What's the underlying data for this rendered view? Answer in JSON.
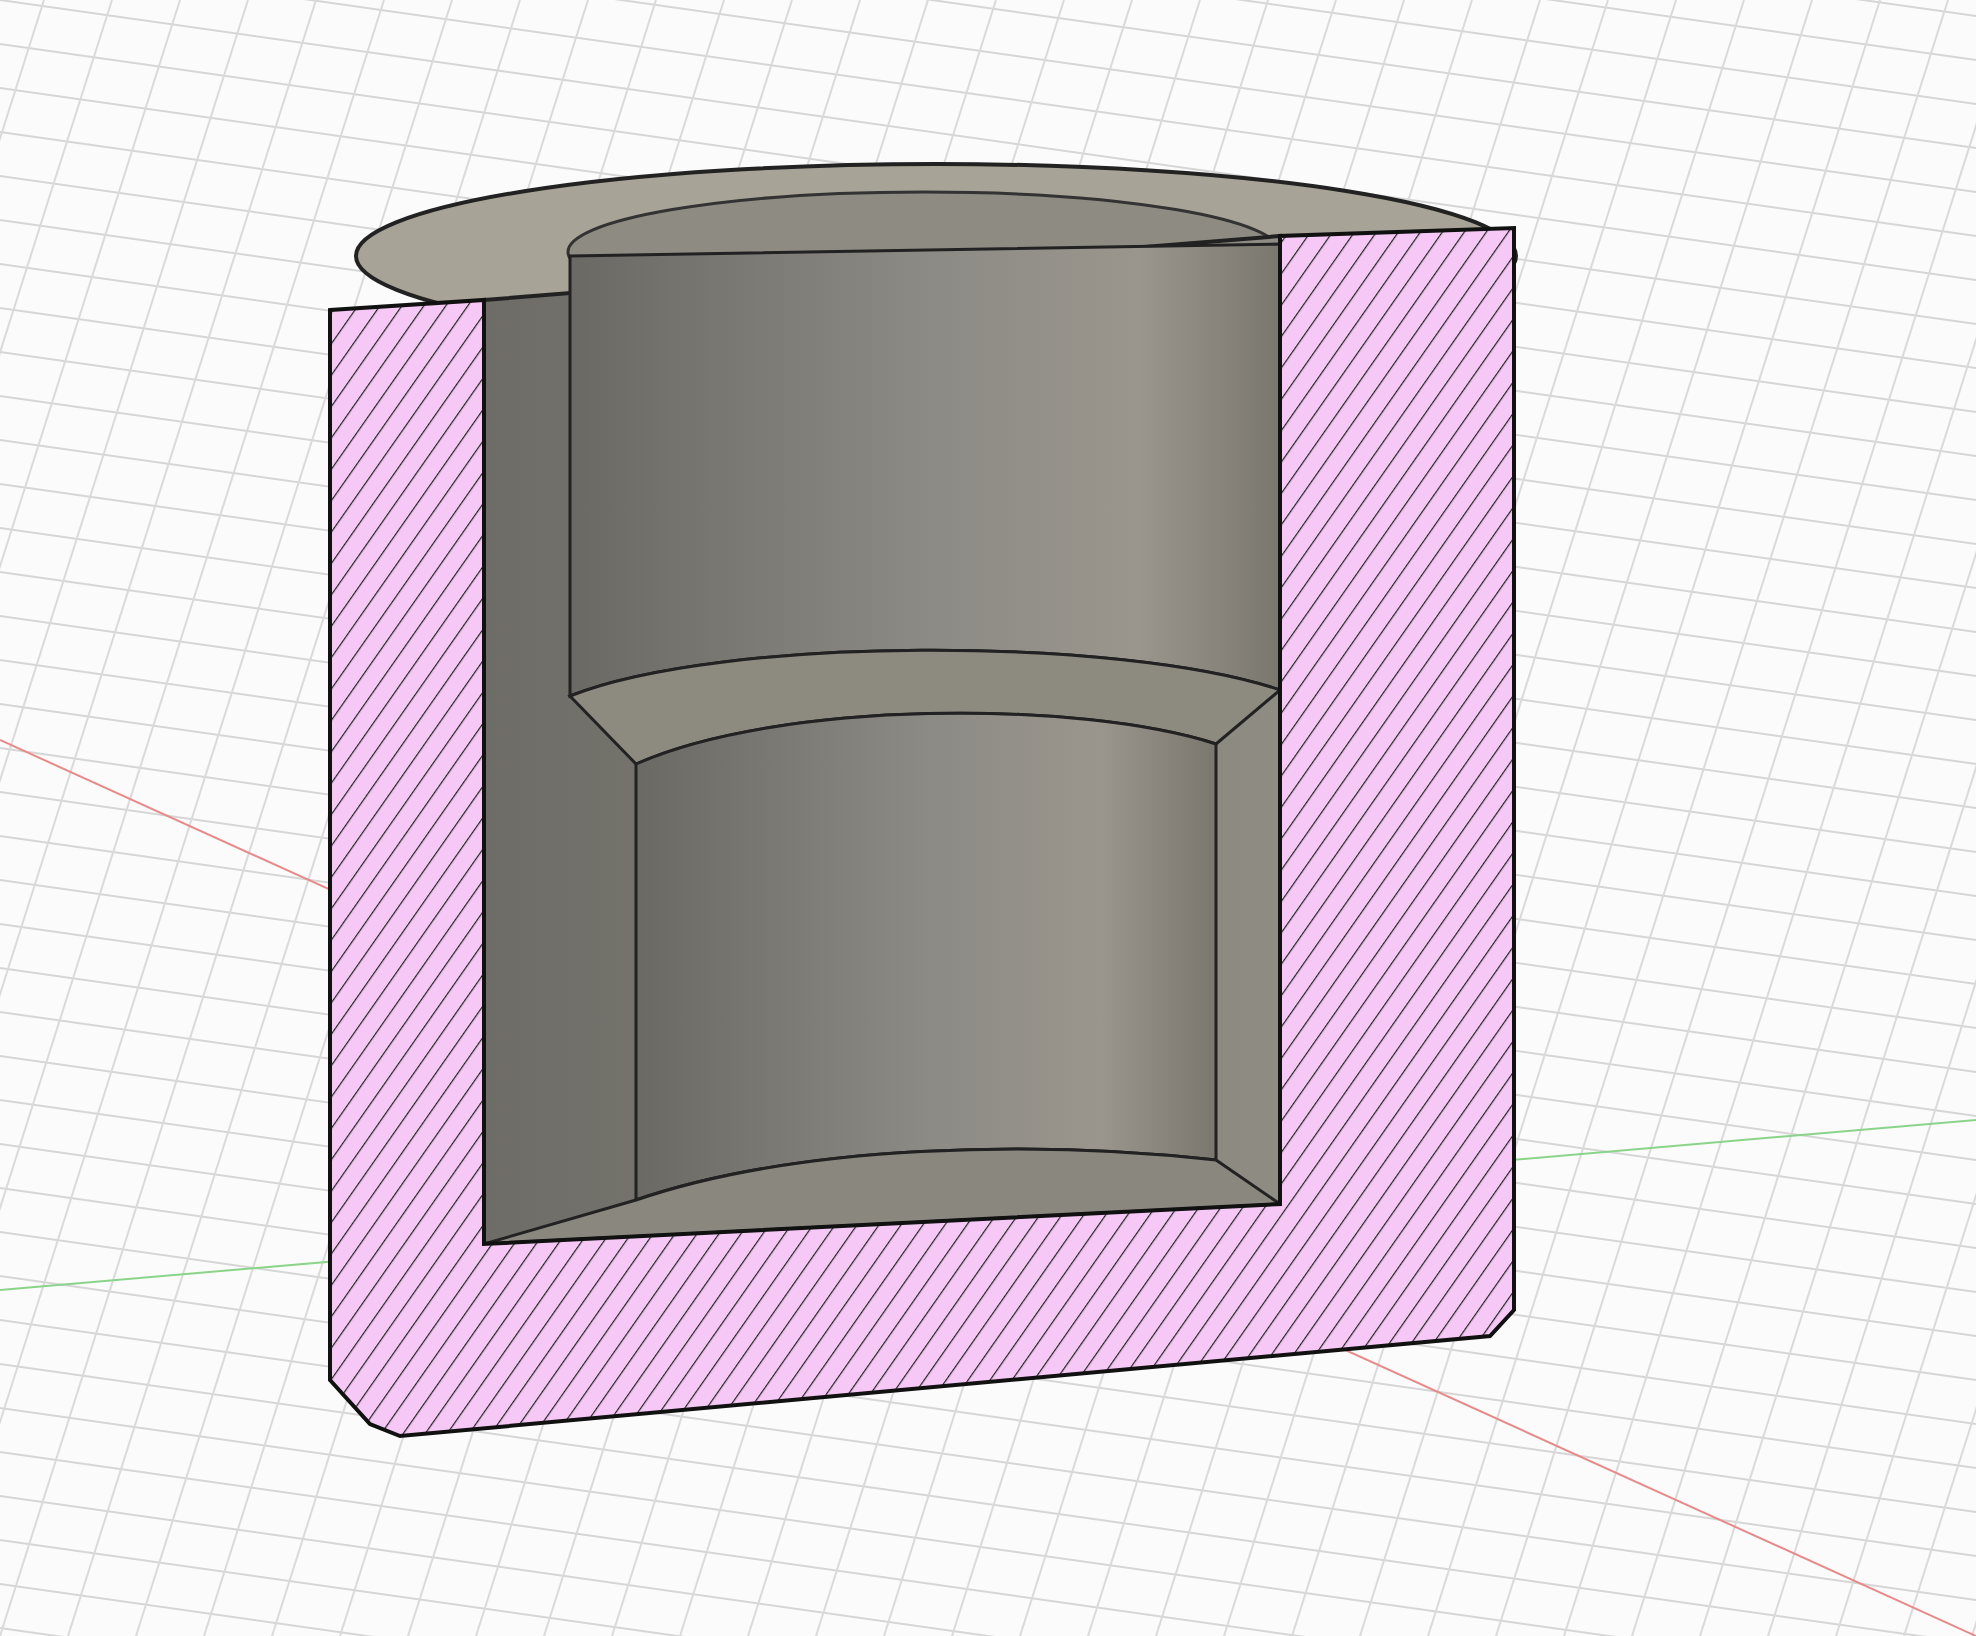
{
  "viewport": {
    "kind": "section-view",
    "grid": true
  }
}
